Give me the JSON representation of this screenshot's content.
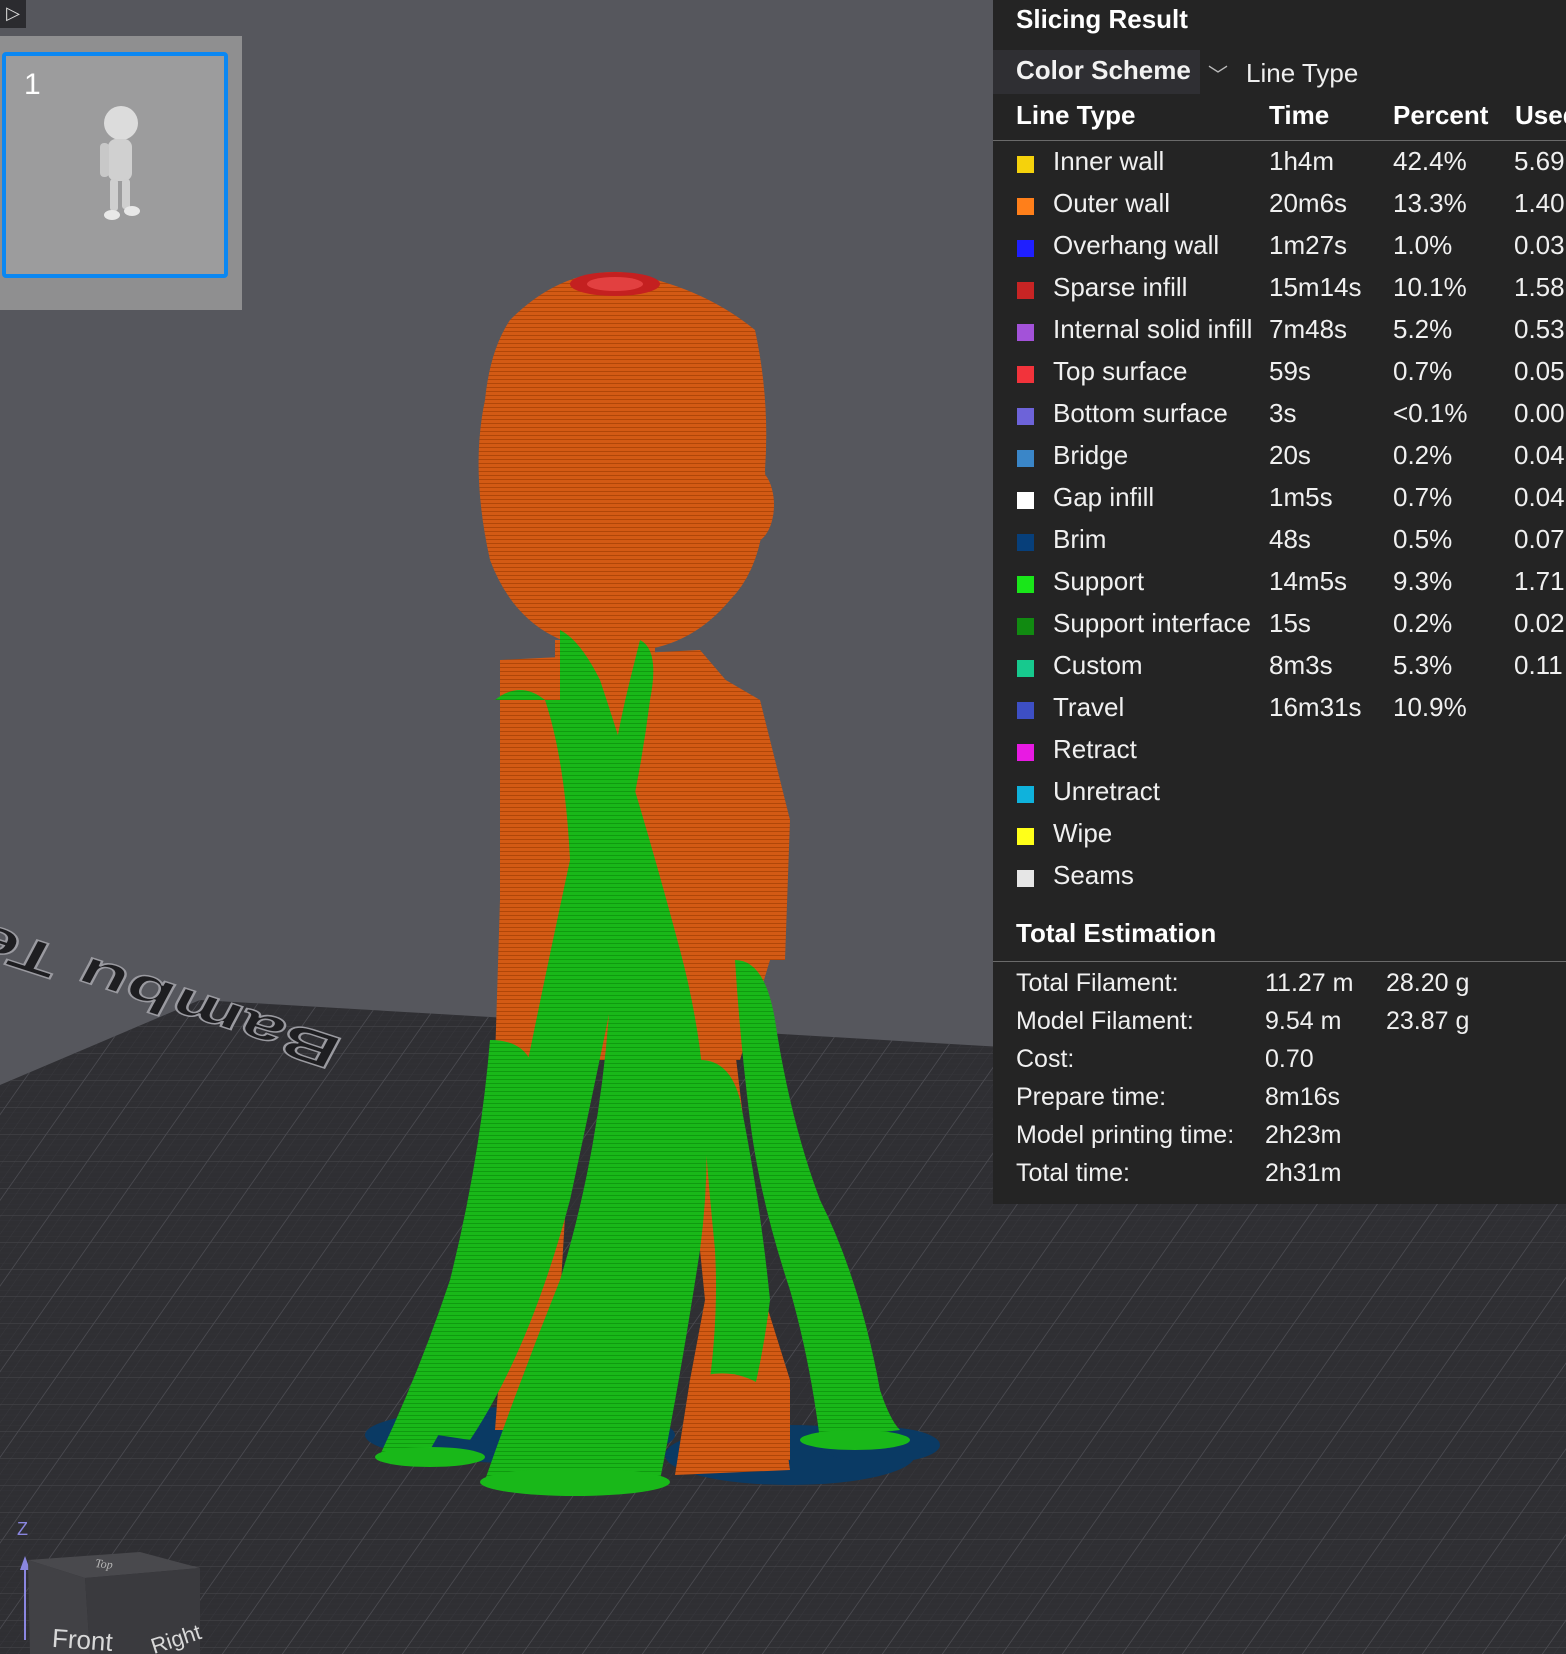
{
  "toolbar": {
    "collapse_icon": "collapse-panel-icon",
    "collapse_glyph": "▷"
  },
  "plate_list": {
    "plates": [
      {
        "number": "1",
        "selected": true
      }
    ]
  },
  "viewport": {
    "bed_text": "Bambu Textu",
    "nav_cube": {
      "axis_label": "Z",
      "top_label": "Top",
      "front_label": "Front",
      "right_label": "Right"
    },
    "colors": {
      "outer_wall": "#d35a14",
      "support": "#17b817",
      "brim": "#0a3a64",
      "bed": "#2e2e32",
      "background": "#56575d"
    }
  },
  "slicing_result": {
    "title": "Slicing Result",
    "color_scheme": {
      "label": "Color Scheme",
      "selected": "Line Type"
    },
    "columns": [
      "Line Type",
      "Time",
      "Percent",
      "Used"
    ],
    "rows": [
      {
        "name": "Inner wall",
        "color": "#f5d20c",
        "time": "1h4m",
        "percent": "42.4%",
        "used": "5.69"
      },
      {
        "name": "Outer wall",
        "color": "#ff7f1a",
        "time": "20m6s",
        "percent": "13.3%",
        "used": "1.40"
      },
      {
        "name": "Overhang wall",
        "color": "#1f1fff",
        "time": "1m27s",
        "percent": "1.0%",
        "used": "0.03"
      },
      {
        "name": "Sparse infill",
        "color": "#c72424",
        "time": "15m14s",
        "percent": "10.1%",
        "used": "1.58"
      },
      {
        "name": "Internal solid infill",
        "color": "#a352d9",
        "time": "7m48s",
        "percent": "5.2%",
        "used": "0.53"
      },
      {
        "name": "Top surface",
        "color": "#f2333b",
        "time": "59s",
        "percent": "0.7%",
        "used": "0.05"
      },
      {
        "name": "Bottom surface",
        "color": "#6d63d9",
        "time": "3s",
        "percent": "<0.1%",
        "used": "0.00"
      },
      {
        "name": "Bridge",
        "color": "#3a86c8",
        "time": "20s",
        "percent": "0.2%",
        "used": "0.04"
      },
      {
        "name": "Gap infill",
        "color": "#ffffff",
        "time": "1m5s",
        "percent": "0.7%",
        "used": "0.04"
      },
      {
        "name": "Brim",
        "color": "#073f7a",
        "time": "48s",
        "percent": "0.5%",
        "used": "0.07"
      },
      {
        "name": "Support",
        "color": "#19e619",
        "time": "14m5s",
        "percent": "9.3%",
        "used": "1.71"
      },
      {
        "name": "Support interface",
        "color": "#118a11",
        "time": "15s",
        "percent": "0.2%",
        "used": "0.02"
      },
      {
        "name": "Custom",
        "color": "#17c98e",
        "time": "8m3s",
        "percent": "5.3%",
        "used": "0.11"
      },
      {
        "name": "Travel",
        "color": "#3d4fc4",
        "time": "16m31s",
        "percent": "10.9%",
        "used": ""
      },
      {
        "name": "Retract",
        "color": "#e81ae3",
        "time": "",
        "percent": "",
        "used": ""
      },
      {
        "name": "Unretract",
        "color": "#0fb2dc",
        "time": "",
        "percent": "",
        "used": ""
      },
      {
        "name": "Wipe",
        "color": "#ffff19",
        "time": "",
        "percent": "",
        "used": ""
      },
      {
        "name": "Seams",
        "color": "#e6e6e6",
        "time": "",
        "percent": "",
        "used": ""
      }
    ],
    "total_estimation": {
      "title": "Total Estimation",
      "rows": [
        {
          "label": "Total Filament:",
          "value1": "11.27 m",
          "value2": "28.20 g"
        },
        {
          "label": "Model Filament:",
          "value1": "9.54 m",
          "value2": "23.87 g"
        },
        {
          "label": "Cost:",
          "value1": "0.70",
          "value2": ""
        },
        {
          "label": "Prepare time:",
          "value1": "8m16s",
          "value2": ""
        },
        {
          "label": "Model printing time:",
          "value1": "2h23m",
          "value2": ""
        },
        {
          "label": "Total time:",
          "value1": "2h31m",
          "value2": ""
        }
      ]
    }
  }
}
